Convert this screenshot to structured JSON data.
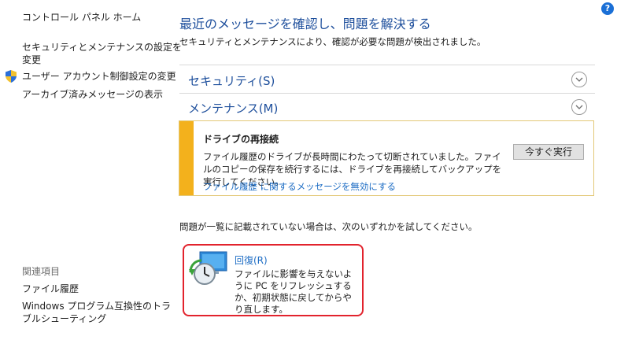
{
  "sidebar": {
    "home_label": "コントロール パネル ホーム",
    "items": [
      {
        "label_line1": "セキュリティとメンテナンスの設定を",
        "label_line2": "変更"
      },
      {
        "label": "ユーザー アカウント制御設定の変更",
        "icon": "uac-shield-icon"
      },
      {
        "label": "アーカイブ済みメッセージの表示"
      }
    ],
    "related": {
      "heading": "関連項目",
      "items": [
        {
          "label": "ファイル履歴"
        },
        {
          "label_line1": "Windows プログラム互換性のトラ",
          "label_line2": "ブルシューティング"
        }
      ]
    }
  },
  "header": {
    "help_icon": "?",
    "title": "最近のメッセージを確認し、問題を解決する",
    "subtitle": "セキュリティとメンテナンスにより、確認が必要な問題が検出されました。"
  },
  "sections": {
    "security": {
      "label": "セキュリティ(S)"
    },
    "maintenance": {
      "label": "メンテナンス(M)"
    }
  },
  "alert": {
    "title": "ドライブの再接続",
    "body": "ファイル履歴のドライブが長時間にわたって切断されていました。ファイルのコピーの保存を続行するには、ドライブを再接続してバックアップを実行してください。",
    "link": "ファイル履歴 に関するメッセージを無効にする",
    "button": "今すぐ実行",
    "accent_color": "#f3b11c"
  },
  "hint": "問題が一覧に記載されていない場合は、次のいずれかを試してください。",
  "recovery": {
    "label": "回復(R)",
    "description": "ファイルに影響を与えないように PC をリフレッシュするか、初期状態に戻してからやり直します。",
    "icon": "recovery-clock-icon",
    "highlight_color": "#e2232d"
  }
}
